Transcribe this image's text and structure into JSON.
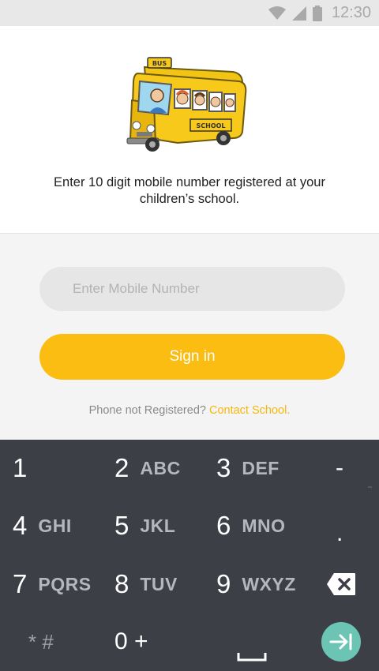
{
  "status_bar": {
    "time": "12:30",
    "icons": [
      "wifi-icon",
      "signal-icon",
      "battery-icon"
    ]
  },
  "header": {
    "illustration": {
      "bus_sign": "BUS",
      "side_sign": "SCHOOL"
    },
    "instruction": "Enter 10 digit mobile number registered at your children’s school."
  },
  "form": {
    "phone_placeholder": "Enter Mobile Number",
    "phone_value": "",
    "signin_label": "Sign in",
    "not_registered_text": "Phone not Registered?",
    "contact_link": "Contact School."
  },
  "keyboard": {
    "rows": [
      [
        {
          "num": "1",
          "letters": ""
        },
        {
          "num": "2",
          "letters": "ABC"
        },
        {
          "num": "3",
          "letters": "DEF"
        },
        {
          "sym": "-"
        }
      ],
      [
        {
          "num": "4",
          "letters": "GHI"
        },
        {
          "num": "5",
          "letters": "JKL"
        },
        {
          "num": "6",
          "letters": "MNO"
        },
        {
          "sym": "."
        }
      ],
      [
        {
          "num": "7",
          "letters": "PQRS"
        },
        {
          "num": "8",
          "letters": "TUV"
        },
        {
          "num": "9",
          "letters": "WXYZ"
        },
        {
          "icon": "backspace-icon"
        }
      ],
      [
        {
          "sym": "* #"
        },
        {
          "sym": "0 +"
        },
        {
          "icon": "space-icon"
        },
        {
          "icon": "enter-icon"
        }
      ]
    ]
  },
  "colors": {
    "accent": "#fbbd11",
    "link": "#f5b60e",
    "keyboard_bg": "#3c4046",
    "enter_key": "#6cc4b4"
  }
}
